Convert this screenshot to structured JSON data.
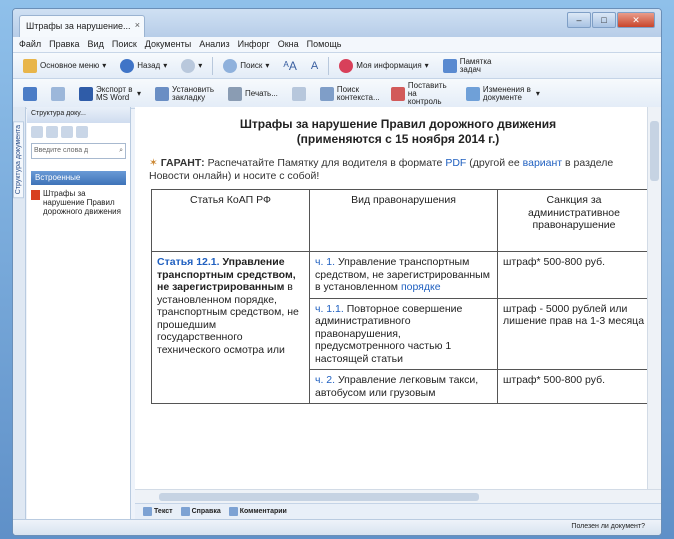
{
  "window": {
    "tab_title": "Штрафы за нарушение...",
    "tab_close": "×",
    "min": "–",
    "max": "□",
    "close": "✕"
  },
  "menu": [
    "Файл",
    "Правка",
    "Вид",
    "Поиск",
    "Документы",
    "Анализ",
    "Инфорг",
    "Окна",
    "Помощь"
  ],
  "toolbar1": {
    "main_menu": "Основное меню",
    "back": "Назад",
    "search": "Поиск",
    "my_info": "Моя информация",
    "reminder": "Памятка задач"
  },
  "toolbar2": {
    "export": "Экспорт в MS Word",
    "bookmark": "Установить закладку",
    "print": "Печать...",
    "find_context": "Поиск контекста...",
    "put_control": "Поставить на контроль",
    "changes": "Изменения в документе"
  },
  "leftpanel": {
    "header": "Структура доку...",
    "search_placeholder": "Введите слова д",
    "selected": "Встроенные",
    "item": "Штрафы за нарушение Правил дорожного движения",
    "vertical_tab": "Структура документа"
  },
  "document": {
    "title_line1": "Штрафы за нарушение Правил дорожного движения",
    "title_line2": "(применяются с 15 ноября 2014 г.)",
    "notice_label": "ГАРАНТ:",
    "notice_text1": "Распечатайте Памятку для водителя в формате",
    "notice_link1": "PDF",
    "notice_text2": "(другой ее",
    "notice_link2": "вариант",
    "notice_text3": "в разделе Новости онлайн) и носите с собой!",
    "table": {
      "headers": [
        "Статья КоАП РФ",
        "Вид правонарушения",
        "Санкция за административное правонарушение"
      ],
      "article_link": "Статья 12.1.",
      "article_text_bold": "Управление транспортным средством, не зарегистрированным",
      "article_text_rest": "в установленном порядке, транспортным средством, не прошедшим государственного технического осмотра или",
      "rows": [
        {
          "part": "ч. 1.",
          "text": "Управление транспортным средством, не зарегистрированным в установленном",
          "link": "порядке",
          "sanction": "штраф* 500-800 руб."
        },
        {
          "part": "ч. 1.1.",
          "text": "Повторное совершение административного правонарушения, предусмотренного частью 1 настоящей статьи",
          "link": "",
          "sanction": "штраф - 5000 рублей или лишение прав на 1-3 месяца"
        },
        {
          "part": "ч. 2.",
          "text": "Управление легковым такси, автобусом или грузовым",
          "link": "",
          "sanction": "штраф* 500-800 руб."
        }
      ]
    }
  },
  "bottomtabs": [
    "Текст",
    "Справка",
    "Комментарии"
  ],
  "status": "Полезен ли документ?"
}
